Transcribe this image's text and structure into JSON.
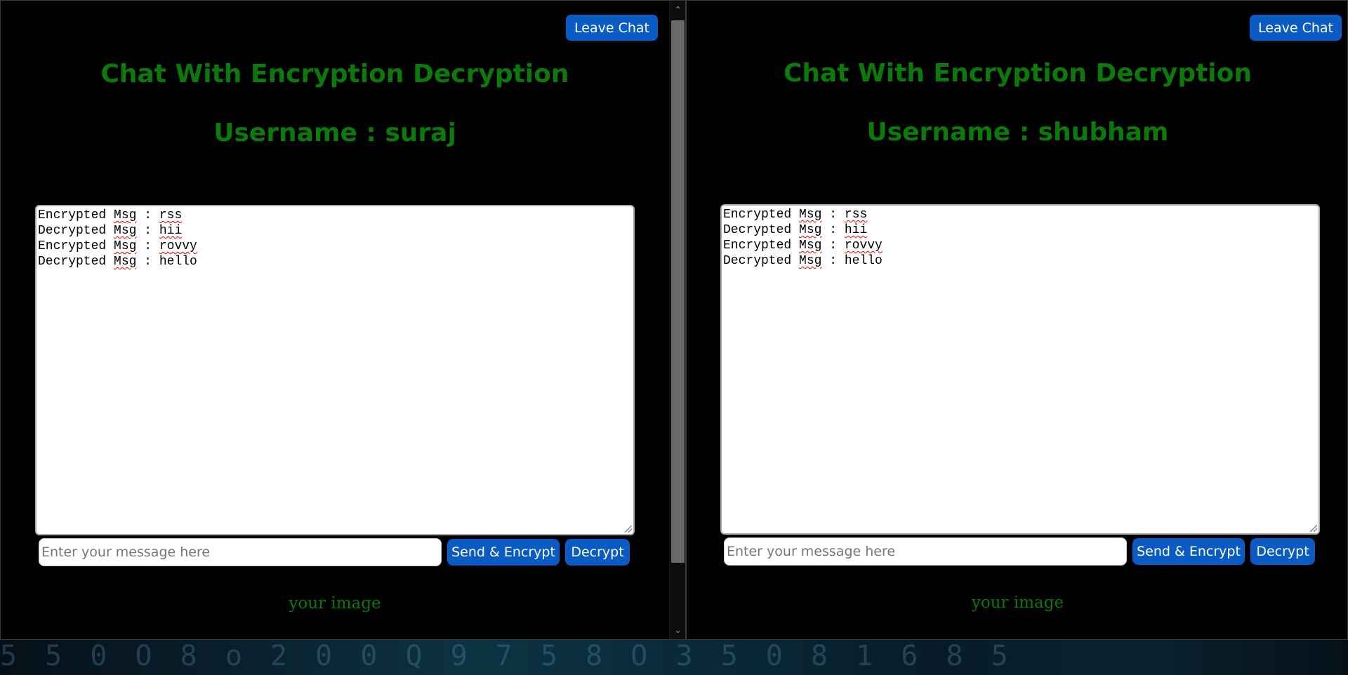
{
  "windows": [
    {
      "leave_label": "Leave Chat",
      "title": "Chat With Encryption Decryption",
      "username_line": "Username : suraj",
      "chat_lines": [
        {
          "prefix": "Encrypted ",
          "word": "Msg",
          "sep": " : ",
          "value": "rss"
        },
        {
          "prefix": "Decrypted ",
          "word": "Msg",
          "sep": " : ",
          "value": "hii"
        },
        {
          "prefix": "Encrypted ",
          "word": "Msg",
          "sep": " : ",
          "value": "rovvy"
        },
        {
          "prefix": "Decrypted ",
          "word": "Msg",
          "sep": " : ",
          "value": "hello"
        }
      ],
      "input_placeholder": "Enter your message here",
      "input_value": "",
      "send_label": "Send & Encrypt",
      "decrypt_label": "Decrypt",
      "image_alt": "your image"
    },
    {
      "leave_label": "Leave Chat",
      "title": "Chat With Encryption Decryption",
      "username_line": "Username : shubham",
      "chat_lines": [
        {
          "prefix": "Encrypted ",
          "word": "Msg",
          "sep": " : ",
          "value": "rss"
        },
        {
          "prefix": "Decrypted ",
          "word": "Msg",
          "sep": " : ",
          "value": "hii"
        },
        {
          "prefix": "Encrypted ",
          "word": "Msg",
          "sep": " : ",
          "value": "rovvy"
        },
        {
          "prefix": "Decrypted ",
          "word": "Msg",
          "sep": " : ",
          "value": "hello"
        }
      ],
      "input_placeholder": "Enter your message here",
      "input_value": "",
      "send_label": "Send & Encrypt",
      "decrypt_label": "Decrypt",
      "image_alt": "your image"
    }
  ],
  "colors": {
    "background": "#000000",
    "heading_green": "#0b7a0b",
    "button_blue": "#0a5cc4",
    "spellcheck_red": "#dd0000"
  },
  "icons": {
    "scroll_up": "chevron-up-icon",
    "scroll_down": "chevron-down-icon",
    "resize": "resize-grip-icon"
  },
  "wallpaper_glyphs": "5  5 0 O 8 o 2 0 0 Q 9    7 5 8 O 3 5 0 8 1 6 8 5"
}
